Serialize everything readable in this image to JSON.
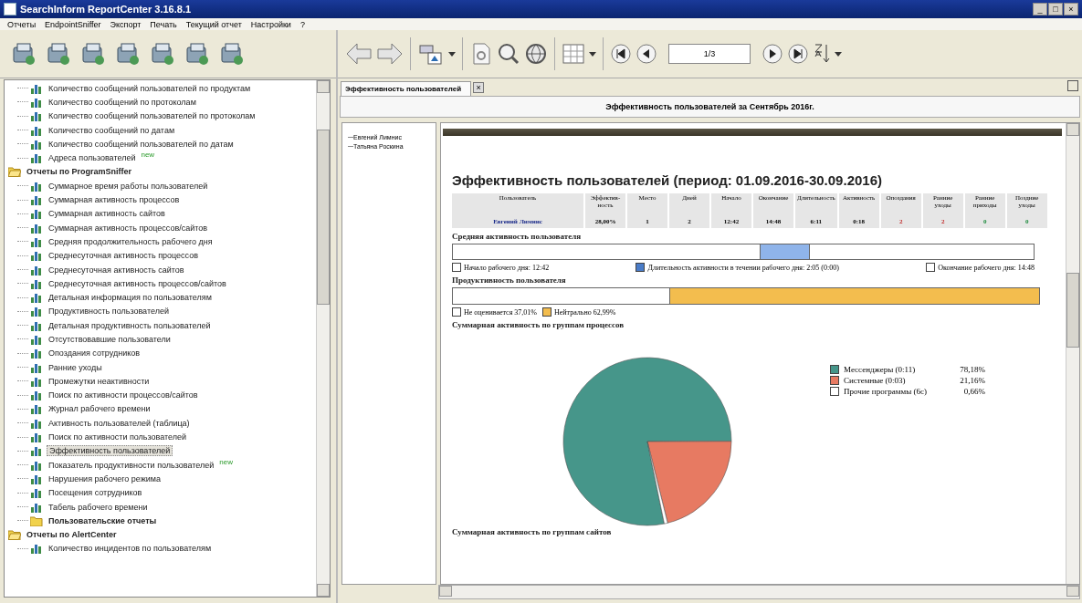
{
  "window": {
    "title": "SearchInform ReportCenter 3.16.8.1",
    "controls": [
      "_",
      "□",
      "×"
    ]
  },
  "menu": [
    "Отчеты",
    "EndpointSniffer",
    "Экспорт",
    "Печать",
    "Текущий отчет",
    "Настройки",
    "?"
  ],
  "tree": [
    {
      "kind": "continued",
      "children": [
        {
          "kind": "item",
          "label": "Количество сообщений пользователей по продуктам",
          "selected": false
        },
        {
          "kind": "item",
          "label": "Количество сообщений по протоколам",
          "selected": false
        },
        {
          "kind": "item",
          "label": "Количество сообщений пользователей по протоколам",
          "selected": false
        },
        {
          "kind": "item",
          "label": "Количество сообщений по датам",
          "selected": false
        },
        {
          "kind": "item",
          "label": "Количество сообщений пользователей по датам",
          "selected": false
        },
        {
          "kind": "item",
          "label": "Адреса пользователей",
          "badge": "new",
          "selected": false
        }
      ]
    },
    {
      "kind": "folder",
      "label": "Отчеты по ProgramSniffer",
      "expanded": true,
      "children": [
        {
          "kind": "item",
          "label": "Суммарное время работы пользователей",
          "selected": false
        },
        {
          "kind": "item",
          "label": "Суммарная активность процессов",
          "selected": false
        },
        {
          "kind": "item",
          "label": "Суммарная активность сайтов",
          "selected": false
        },
        {
          "kind": "item",
          "label": "Суммарная активность процессов/сайтов",
          "selected": false
        },
        {
          "kind": "item",
          "label": "Средняя продолжительность рабочего дня",
          "selected": false
        },
        {
          "kind": "item",
          "label": "Среднесуточная активность процессов",
          "selected": false
        },
        {
          "kind": "item",
          "label": "Среднесуточная активность сайтов",
          "selected": false
        },
        {
          "kind": "item",
          "label": "Среднесуточная активность процессов/сайтов",
          "selected": false
        },
        {
          "kind": "item",
          "label": "Детальная информация по пользователям",
          "selected": false
        },
        {
          "kind": "item",
          "label": "Продуктивность пользователей",
          "selected": false
        },
        {
          "kind": "item",
          "label": "Детальная продуктивность пользователей",
          "selected": false
        },
        {
          "kind": "item",
          "label": "Отсутствовавшие пользователи",
          "selected": false
        },
        {
          "kind": "item",
          "label": "Опоздания сотрудников",
          "selected": false
        },
        {
          "kind": "item",
          "label": "Ранние уходы",
          "selected": false
        },
        {
          "kind": "item",
          "label": "Промежутки неактивности",
          "selected": false
        },
        {
          "kind": "item",
          "label": "Поиск по активности процессов/сайтов",
          "selected": false
        },
        {
          "kind": "item",
          "label": "Журнал рабочего времени",
          "selected": false
        },
        {
          "kind": "item",
          "label": "Активность пользователей (таблица)",
          "selected": false
        },
        {
          "kind": "item",
          "label": "Поиск по активности пользователей",
          "selected": false
        },
        {
          "kind": "item",
          "label": "Эффективность пользователей",
          "selected": true
        },
        {
          "kind": "item",
          "label": "Показатель продуктивности пользователей",
          "badge": "new",
          "selected": false
        },
        {
          "kind": "item",
          "label": "Нарушения рабочего режима",
          "selected": false
        },
        {
          "kind": "item",
          "label": "Посещения сотрудников",
          "selected": false
        },
        {
          "kind": "item",
          "label": "Табель рабочего времени",
          "selected": false
        },
        {
          "kind": "folder",
          "label": "Пользовательские отчеты",
          "expanded": false
        }
      ]
    },
    {
      "kind": "folder",
      "label": "Отчеты по AlertCenter",
      "expanded": true,
      "children": [
        {
          "kind": "item",
          "label": "Количество инцидентов по пользователям",
          "selected": false
        }
      ]
    }
  ],
  "pager": {
    "value": "1/3"
  },
  "tab": {
    "label": "Эффективность пользователей",
    "close": "×",
    "selected": true
  },
  "report_title": "Эффективность пользователей за Сентябрь 2016г.",
  "users": [
    {
      "name": "Евгений Лимнис",
      "selected": false
    },
    {
      "name": "Татьяна Роскина",
      "selected": false
    }
  ],
  "report": {
    "heading": "Эффективность пользователей (период: 01.09.2016-30.09.2016)",
    "table": {
      "columns": [
        "Пользователь",
        "Эффектив-ность",
        "Место",
        "Дней",
        "Начало",
        "Окончание",
        "Длительность",
        "Активность",
        "Опоздания",
        "Ранние уходы",
        "Ранние приходы",
        "Поздние уходы"
      ],
      "rows": [
        [
          {
            "text": "Евгений Лимнис",
            "kind": "link"
          },
          {
            "text": "28,00%",
            "kind": "plain"
          },
          {
            "text": "1",
            "kind": "plain"
          },
          {
            "text": "2",
            "kind": "plain"
          },
          {
            "text": "12:42",
            "kind": "plain"
          },
          {
            "text": "14:48",
            "kind": "plain"
          },
          {
            "text": "6:11",
            "kind": "plain"
          },
          {
            "text": "0:18",
            "kind": "plain"
          },
          {
            "text": "2",
            "kind": "bad"
          },
          {
            "text": "2",
            "kind": "bad"
          },
          {
            "text": "0",
            "kind": "good"
          },
          {
            "text": "0",
            "kind": "good"
          }
        ]
      ]
    },
    "activity": {
      "title": "Средняя активность пользователя",
      "segments": [
        {
          "color": "#ffffff",
          "level": 0.53
        },
        {
          "color": "#8fb4ea"
        }
      ],
      "legend": [
        {
          "label": "Начало рабочего дня: 12:42",
          "color": "#ffffff"
        },
        {
          "label": "Длительность активности в течении рабочего дня: 2:05 (0:00)",
          "color": "#4a7cc8"
        },
        {
          "label": "Окончание рабочего дня: 14:48",
          "color": "#ffffff"
        }
      ]
    },
    "productivity": {
      "title": "Продуктивность пользователя",
      "segments": [
        {
          "color": "#ffffff",
          "level": 0.37
        },
        {
          "color": "#f3bd4e",
          "level": 0.63
        }
      ],
      "legend": [
        {
          "label": "Не оценивается 37,01%",
          "color": "#ffffff"
        },
        {
          "label": "Нейтрально 62,99%",
          "color": "#f3bd4e"
        }
      ]
    },
    "processes": {
      "title": "Суммарная активность по группам процессов",
      "legend": [
        {
          "label": "Мессенджеры (0:11)",
          "share": "78,18%",
          "color": "#46968a"
        },
        {
          "label": "Системные (0:03)",
          "share": "21,16%",
          "color": "#e77a62"
        },
        {
          "label": "Прочие программы (6с)",
          "share": "0,66%",
          "color": "#ffffff"
        }
      ],
      "chart_data": {
        "type": "pie",
        "values": [
          78.18,
          21.16,
          0.66
        ]
      }
    },
    "sites": {
      "title": "Суммарная активность по группам сайтов"
    }
  }
}
